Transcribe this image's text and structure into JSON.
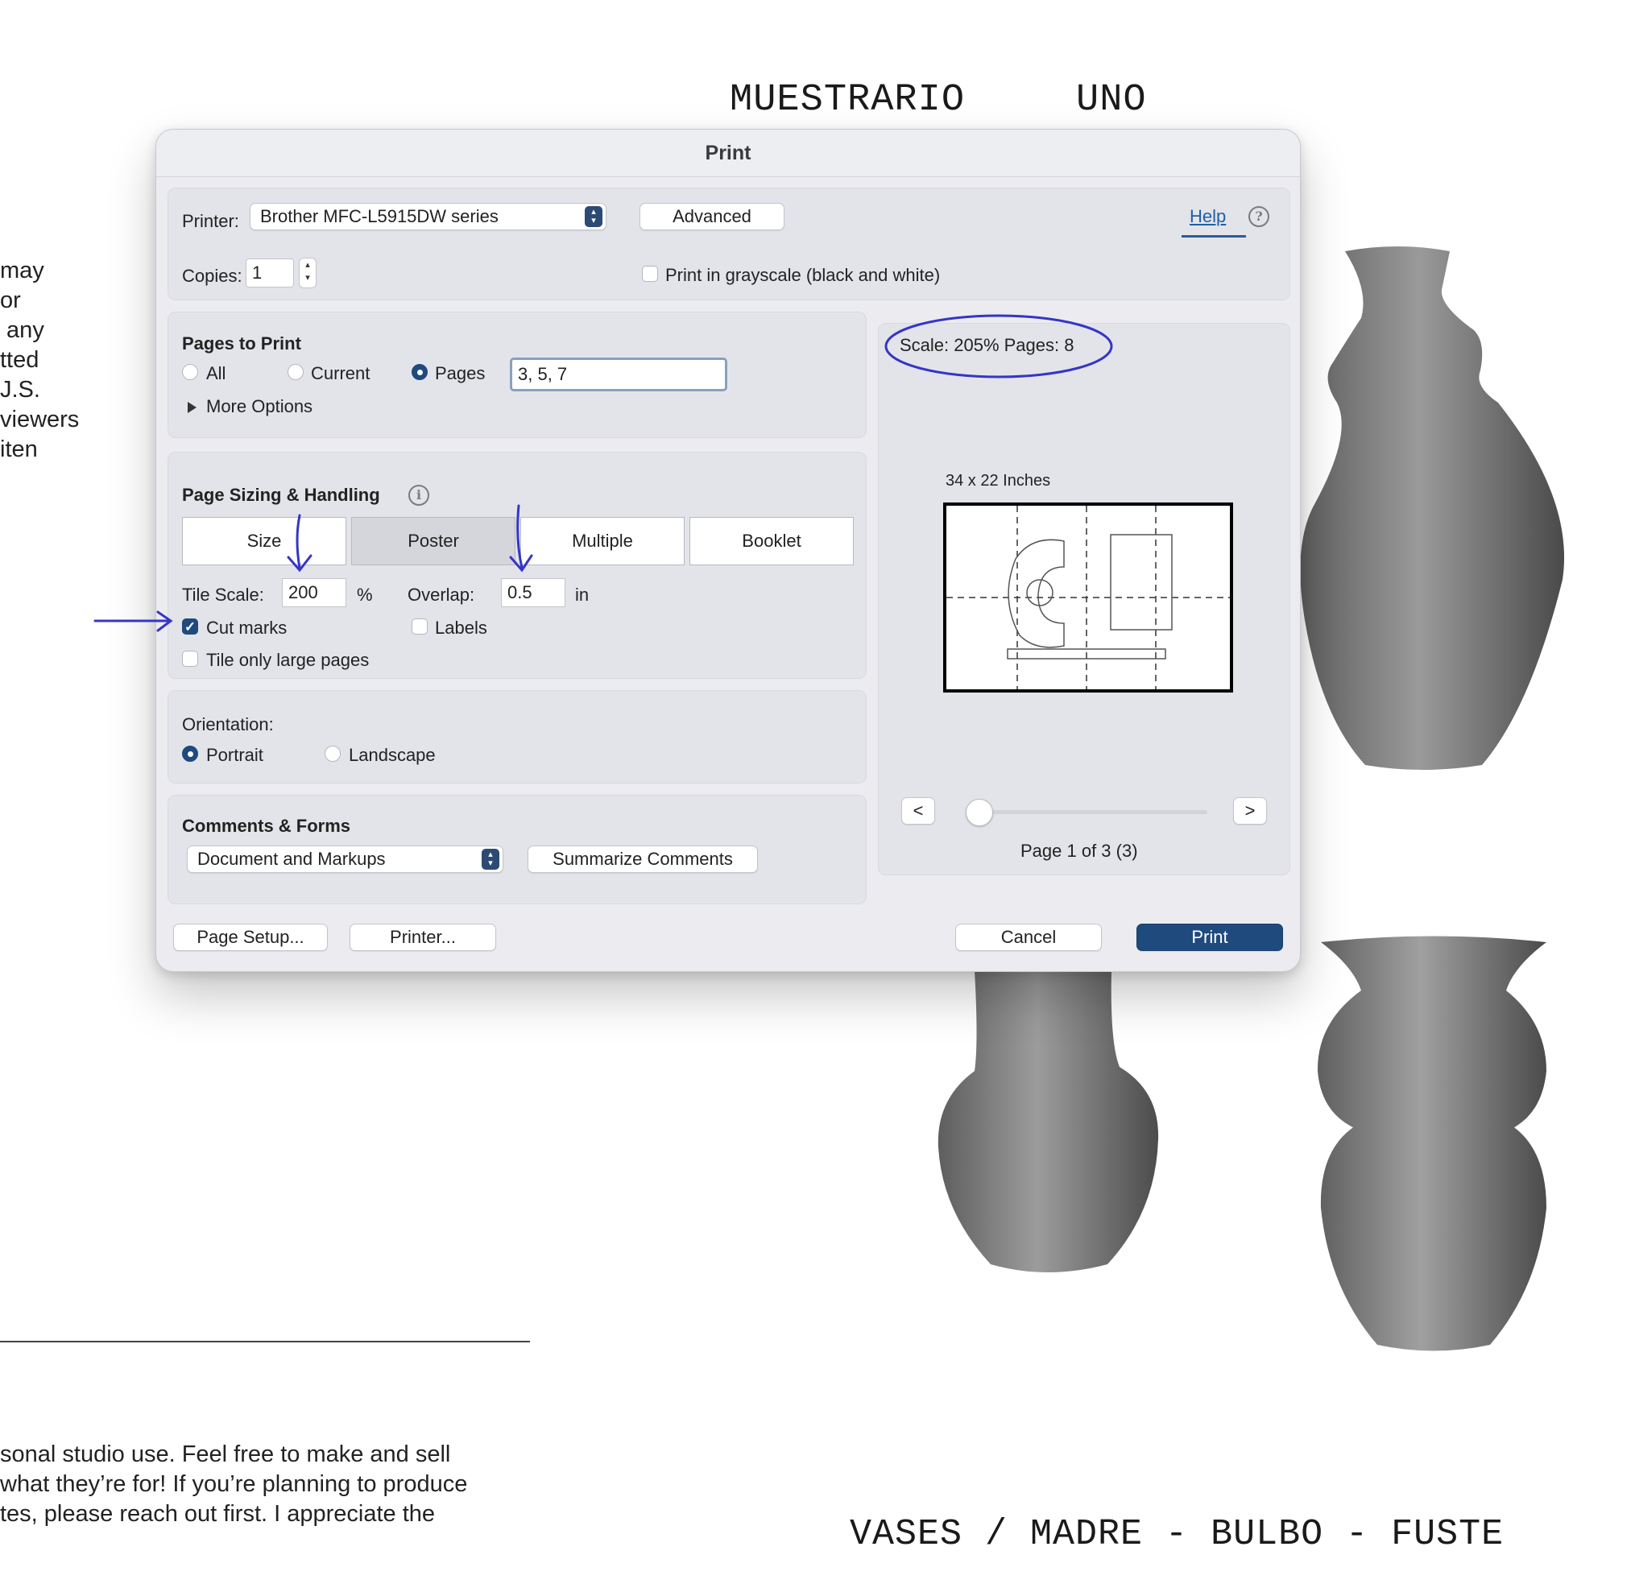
{
  "document": {
    "title_top": [
      "MUESTRARIO",
      "UNO"
    ],
    "title_bottom": "VASES / MADRE - BULBO - FUSTE",
    "side_text_lines": [
      "may",
      "or",
      " any",
      "tted",
      "J.S.",
      "viewers",
      "iten"
    ],
    "bottom_text_lines": [
      "sonal studio use. Feel free to make and sell",
      "what they’re for! If you’re planning to produce",
      "tes, please reach out first. I appreciate the"
    ]
  },
  "dialog": {
    "title": "Print",
    "printer": {
      "label": "Printer:",
      "value": "Brother MFC-L5915DW series",
      "advanced_label": "Advanced",
      "help_label": "Help"
    },
    "copies": {
      "label": "Copies:",
      "value": "1"
    },
    "grayscale": {
      "label": "Print in grayscale (black and white)",
      "checked": false
    },
    "pages_to_print": {
      "header": "Pages to Print",
      "options": [
        "All",
        "Current",
        "Pages"
      ],
      "selected": "Pages",
      "range_value": "3, 5, 7",
      "more_options": "More Options"
    },
    "page_sizing": {
      "header": "Page Sizing & Handling",
      "tabs": [
        "Size",
        "Poster",
        "Multiple",
        "Booklet"
      ],
      "active_tab": "Poster",
      "tile_scale_label": "Tile Scale:",
      "tile_scale_value": "200",
      "tile_scale_unit": "%",
      "overlap_label": "Overlap:",
      "overlap_value": "0.5",
      "overlap_unit": "in",
      "cut_marks_label": "Cut marks",
      "cut_marks_checked": true,
      "labels_label": "Labels",
      "labels_checked": false,
      "tile_only_large_label": "Tile only large pages",
      "tile_only_large_checked": false
    },
    "orientation": {
      "header": "Orientation:",
      "options": [
        "Portrait",
        "Landscape"
      ],
      "selected": "Portrait"
    },
    "comments_forms": {
      "header": "Comments & Forms",
      "value": "Document and Markups",
      "summarize_label": "Summarize Comments"
    },
    "preview": {
      "scale_text": "Scale: 205% Pages: 8",
      "size_text": "34 x 22 Inches",
      "prev_label": "<",
      "next_label": ">",
      "page_text": "Page 1 of 3 (3)",
      "slider_position": 0.0
    },
    "footer": {
      "page_setup_label": "Page Setup...",
      "printer_label": "Printer...",
      "cancel_label": "Cancel",
      "print_label": "Print"
    }
  },
  "colors": {
    "accent": "#1f4a7d",
    "annotation_ink": "#3535c8",
    "dialog_bg": "#ececf0",
    "panel_bg": "#e3e4ea"
  }
}
